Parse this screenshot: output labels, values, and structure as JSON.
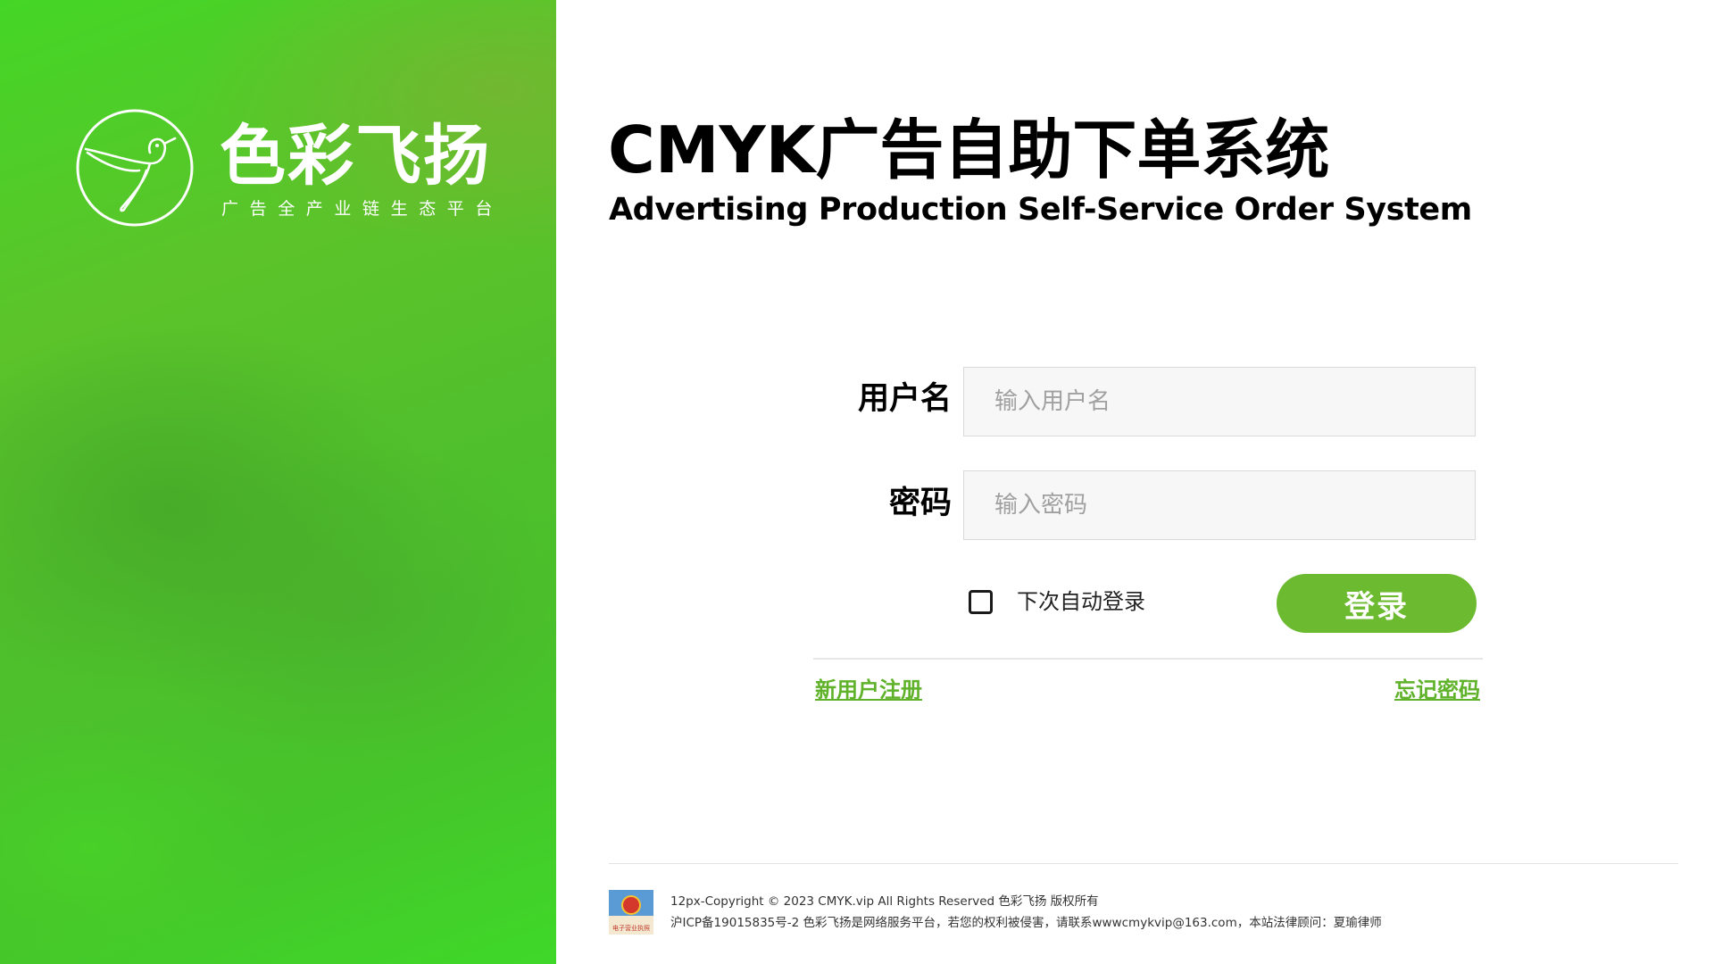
{
  "brand": {
    "name": "色彩飞扬",
    "slogan": "广告全产业链生态平台"
  },
  "header": {
    "title_cn": "CMYK广告自助下单系统",
    "title_en": "Advertising Production Self-Service Order System"
  },
  "login_form": {
    "username_label": "用户名",
    "username_placeholder": "输入用户名",
    "password_label": "密码",
    "password_placeholder": "输入密码",
    "remember_label": "下次自动登录",
    "remember_checked": false,
    "login_button": "登录",
    "register_link": "新用户注册",
    "forgot_link": "忘记密码"
  },
  "footer": {
    "badge_text": "电子营业执照",
    "copyright": "12px-Copyright © 2023 CMYK.vip All Rights Reserved 色彩飞扬 版权所有",
    "icp": "沪ICP备19015835号-2 色彩飞扬是网络服务平台，若您的权利被侵害，请联系wwwcmykvip@163.com，本站法律顾问：夏瑜律师"
  },
  "colors": {
    "brand_green": "#6cba2f",
    "link_green": "#5fb22a",
    "panel_green": "#44d626"
  },
  "icons": {
    "logo": "hummingbird-icon",
    "license": "business-license-icon"
  }
}
